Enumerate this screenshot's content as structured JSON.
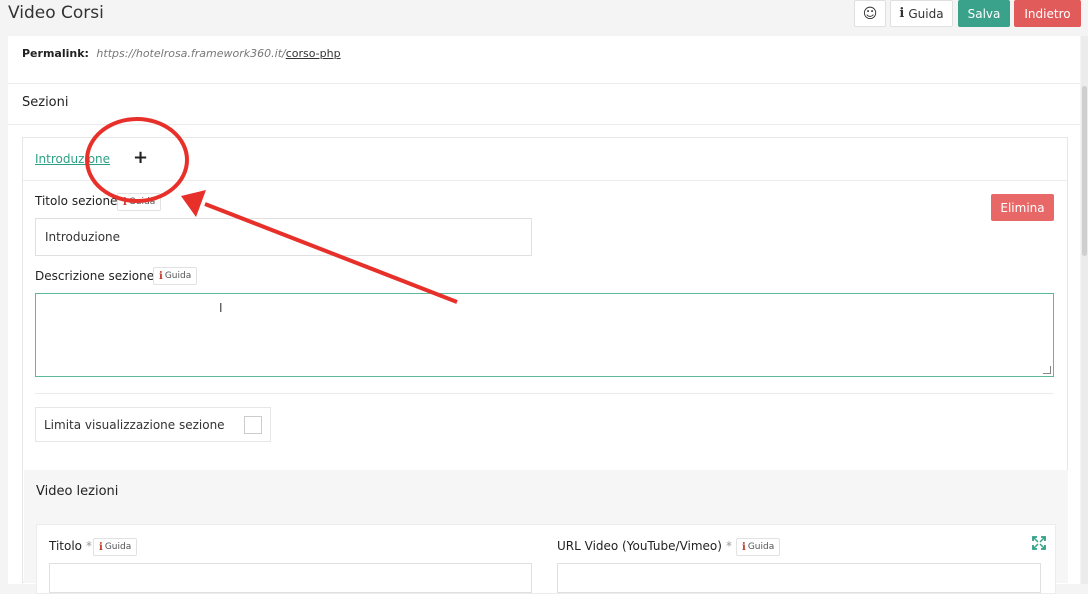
{
  "window": {
    "title": "Video Corsi"
  },
  "toolbar": {
    "emoji_icon": "smiley-icon",
    "emoji_glyph": "☺",
    "guida_label": "Guida",
    "salva_label": "Salva",
    "indietro_label": "Indietro",
    "colors": {
      "salva": "#3aa28a",
      "indietro": "#e15b5b"
    }
  },
  "permalink": {
    "label": "Permalink:",
    "base_url": "https://hotelrosa.framework360.it/",
    "slug": "corso-php"
  },
  "sezioni": {
    "title": "Sezioni",
    "tabs": [
      {
        "label": "Introduzione",
        "active": true
      }
    ],
    "add_tab_glyph": "+",
    "titolo_label": "Titolo sezione",
    "titolo_value": "Introduzione",
    "guida_label": "Guida",
    "descrizione_label": "Descrizione sezione",
    "descrizione_value": "",
    "elimina_label": "Elimina",
    "limita_label": "Limita visualizzazione sezione",
    "limita_checked": false
  },
  "video_lezioni": {
    "title": "Video lezioni",
    "titolo_label": "Titolo",
    "url_label": "URL Video (YouTube/Vimeo)",
    "required_marker": "*",
    "guida_label": "Guida"
  },
  "annotation": {
    "shapes": "red circle around add tab with arrow",
    "color": "#e8302a"
  }
}
